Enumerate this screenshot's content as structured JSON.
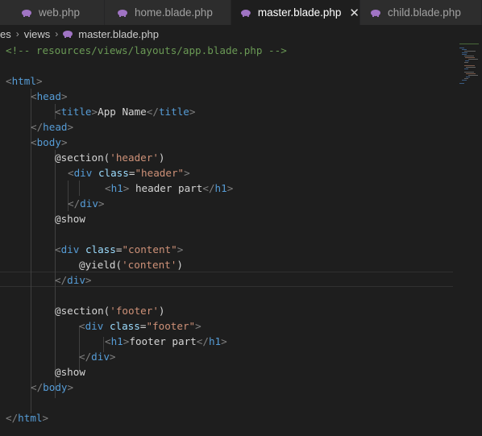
{
  "tabs": [
    {
      "label": "web.php",
      "active": false
    },
    {
      "label": "home.blade.php",
      "active": false
    },
    {
      "label": "master.blade.php",
      "active": true
    },
    {
      "label": "child.blade.php",
      "active": false
    }
  ],
  "close_glyph": "✕",
  "breadcrumb": {
    "items": [
      "es",
      "views",
      "master.blade.php"
    ],
    "separator": "›"
  },
  "editor": {
    "line_comment": "<!-- resources/views/layouts/app.blade.php -->",
    "line_html_open": "<html>",
    "line_head_open": "<head>",
    "line_title": "<title>App Name</title>",
    "line_head_close": "</head>",
    "line_body_open": "<body>",
    "line_section_header": "@section('header')",
    "line_div_header": "<div class=\"header\">",
    "line_h1_header": "<h1> header part</h1>",
    "line_div_close_1": "</div>",
    "line_show_1": "@show",
    "line_div_content": "<div class=\"content\">",
    "line_yield": "@yield('content')",
    "line_div_close_2": "</div>",
    "line_section_footer": "@section('footer')",
    "line_div_footer": "<div class=\"footer\">",
    "line_h1_footer": "<h1>footer part</h1>",
    "line_div_close_3": "</div>",
    "line_show_2": "@show",
    "line_body_close": "</body>",
    "line_html_close": "</html>"
  },
  "colors": {
    "background": "#1e1e1e",
    "tag": "#569cd6",
    "attribute": "#9cdcfe",
    "string": "#ce9178",
    "comment": "#6a9955",
    "text": "#d4d4d4",
    "php_icon": "#a074c4"
  },
  "icons": {
    "file_icon": "php-elephant-icon",
    "close_icon": "close-icon",
    "breadcrumb_separator": "chevron-right-icon"
  }
}
